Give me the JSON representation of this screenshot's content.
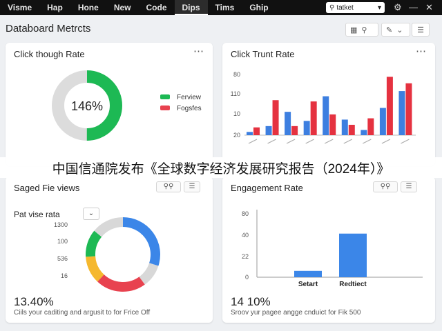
{
  "nav": {
    "tabs": [
      "Visme",
      "Hap",
      "Hone",
      "New",
      "Code",
      "Dips",
      "Tims",
      "Ghip"
    ],
    "active_index": 5,
    "search_label": "tatket",
    "accent": "#ffffff"
  },
  "header": {
    "title": "Databoard Metrcts"
  },
  "banner": {
    "text": "中国信通院发布《全球数字经济发展研究报告（2024年）》"
  },
  "cards": {
    "click_through": {
      "title": "Click though Rate",
      "center_label": "146%",
      "legend": [
        {
          "label": "Ferview",
          "color": "#1db954"
        },
        {
          "label": "Fogsfes",
          "color": "#e8424f"
        }
      ],
      "donut_fraction": 0.5,
      "colors": {
        "fill": "#1db954",
        "track": "#dcdcdc"
      }
    },
    "click_trunt": {
      "title": "Click Trunt Rate"
    },
    "saged_views": {
      "title": "Saged Fie views",
      "subtitle": "Pat vise rata",
      "dropdown": "⌄",
      "metric": "13.40%",
      "caption": "Ciils your caditing and argusit to for Frice Off"
    },
    "engagement": {
      "title": "Engagement Rate",
      "metric": "14 10%",
      "caption": "Sroov yur pagee angge cnduict for Fik 500"
    }
  },
  "chart_data": [
    {
      "type": "bar",
      "title": "Click Trunt Rate",
      "y_ticks": [
        "80",
        "110",
        "10",
        "20"
      ],
      "ylim": [
        0,
        100
      ],
      "series": [
        {
          "color": "#3d7fe0",
          "values": [
            5,
            14,
            36,
            22,
            60,
            24,
            8,
            42,
            68
          ]
        },
        {
          "color": "#e53240",
          "values": [
            12,
            54,
            14,
            52,
            32,
            16,
            26,
            90,
            80
          ]
        }
      ],
      "grid": false,
      "legend": "none"
    },
    {
      "type": "pie",
      "title": "Saged Fie views",
      "y_ticks": [
        "1300",
        "100",
        "536",
        "16"
      ],
      "slices": [
        {
          "value": 30,
          "color": "#3b86e8"
        },
        {
          "value": 10,
          "color": "#d8d8d8"
        },
        {
          "value": 22,
          "color": "#e8424f"
        },
        {
          "value": 12,
          "color": "#f5b82e"
        },
        {
          "value": 12,
          "color": "#1db954"
        },
        {
          "value": 14,
          "color": "#d8d8d8"
        }
      ]
    },
    {
      "type": "bar",
      "title": "Engagement Rate",
      "categories": [
        "Setart",
        "Redtiect"
      ],
      "values": [
        8,
        55
      ],
      "ylim": [
        0,
        80
      ],
      "y_ticks": [
        "80",
        "40",
        "22",
        "0"
      ],
      "color": "#3b86e8"
    }
  ]
}
